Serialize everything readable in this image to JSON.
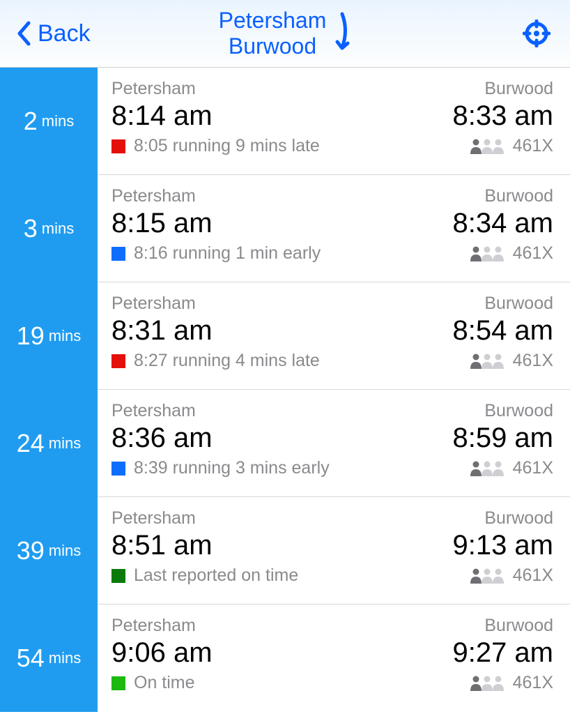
{
  "header": {
    "back_label": "Back",
    "from": "Petersham",
    "to": "Burwood"
  },
  "trips": [
    {
      "wait_num": "2",
      "wait_unit": "mins",
      "from": "Petersham",
      "to": "Burwood",
      "depart": "8:14 am",
      "arrive": "8:33 am",
      "status_color": "red",
      "status_text": "8:05 running 9 mins late",
      "occupancy": 1,
      "route": "461X"
    },
    {
      "wait_num": "3",
      "wait_unit": "mins",
      "from": "Petersham",
      "to": "Burwood",
      "depart": "8:15 am",
      "arrive": "8:34 am",
      "status_color": "blue",
      "status_text": "8:16 running 1 min early",
      "occupancy": 1,
      "route": "461X"
    },
    {
      "wait_num": "19",
      "wait_unit": "mins",
      "from": "Petersham",
      "to": "Burwood",
      "depart": "8:31 am",
      "arrive": "8:54 am",
      "status_color": "red",
      "status_text": "8:27 running 4 mins late",
      "occupancy": 1,
      "route": "461X"
    },
    {
      "wait_num": "24",
      "wait_unit": "mins",
      "from": "Petersham",
      "to": "Burwood",
      "depart": "8:36 am",
      "arrive": "8:59 am",
      "status_color": "blue",
      "status_text": "8:39 running 3 mins early",
      "occupancy": 1,
      "route": "461X"
    },
    {
      "wait_num": "39",
      "wait_unit": "mins",
      "from": "Petersham",
      "to": "Burwood",
      "depart": "8:51 am",
      "arrive": "9:13 am",
      "status_color": "darkgreen",
      "status_text": "Last reported on time",
      "occupancy": 1,
      "route": "461X"
    },
    {
      "wait_num": "54",
      "wait_unit": "mins",
      "from": "Petersham",
      "to": "Burwood",
      "depart": "9:06 am",
      "arrive": "9:27 am",
      "status_color": "green",
      "status_text": "On time",
      "occupancy": 1,
      "route": "461X"
    }
  ]
}
